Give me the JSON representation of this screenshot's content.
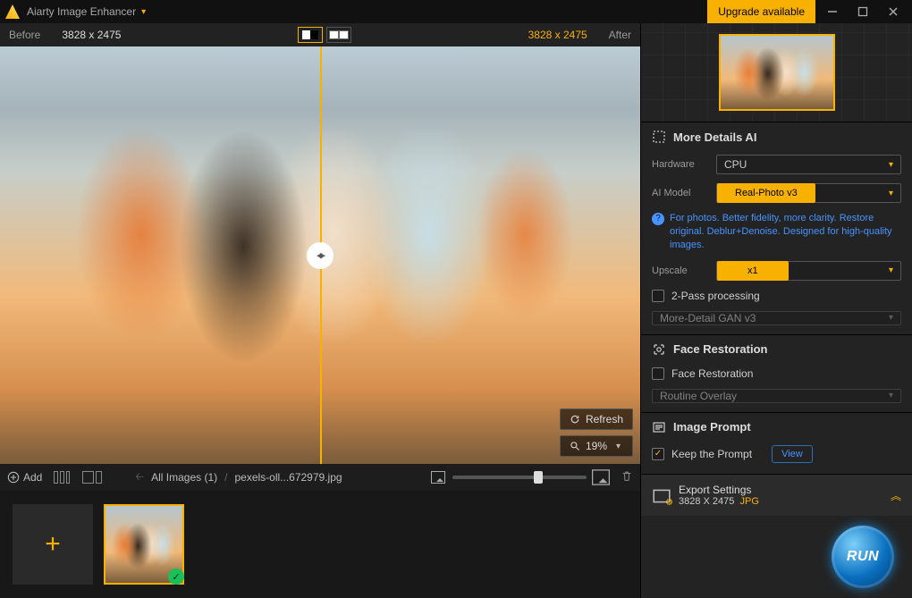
{
  "titlebar": {
    "app_name": "Aiarty Image Enhancer",
    "upgrade": "Upgrade available"
  },
  "preview": {
    "before_label": "Before",
    "after_label": "After",
    "before_dim": "3828 x 2475",
    "after_dim": "3828 x 2475",
    "refresh": "Refresh",
    "zoom": "19%"
  },
  "toolrow": {
    "add": "Add",
    "crumb_all": "All Images (1)",
    "crumb_file": "pexels-oll...672979.jpg"
  },
  "thumb_slider": 65,
  "panel": {
    "more_details_ai": "More Details AI",
    "hardware_label": "Hardware",
    "hardware_value": "CPU",
    "model_label": "AI Model",
    "model_value": "Real-Photo  v3",
    "model_hint": "For photos. Better fidelity, more clarity. Restore original. Deblur+Denoise. Designed for high-quality images.",
    "upscale_label": "Upscale",
    "upscale_value": "x1",
    "two_pass": "2-Pass processing",
    "two_pass_model": "More-Detail GAN  v3",
    "face_section": "Face Restoration",
    "face_check": "Face Restoration",
    "face_mode": "Routine Overlay",
    "prompt_section": "Image Prompt",
    "keep_prompt": "Keep the Prompt",
    "view": "View"
  },
  "export": {
    "title": "Export Settings",
    "dim": "3828 X 2475",
    "fmt": "JPG"
  },
  "run": "RUN"
}
